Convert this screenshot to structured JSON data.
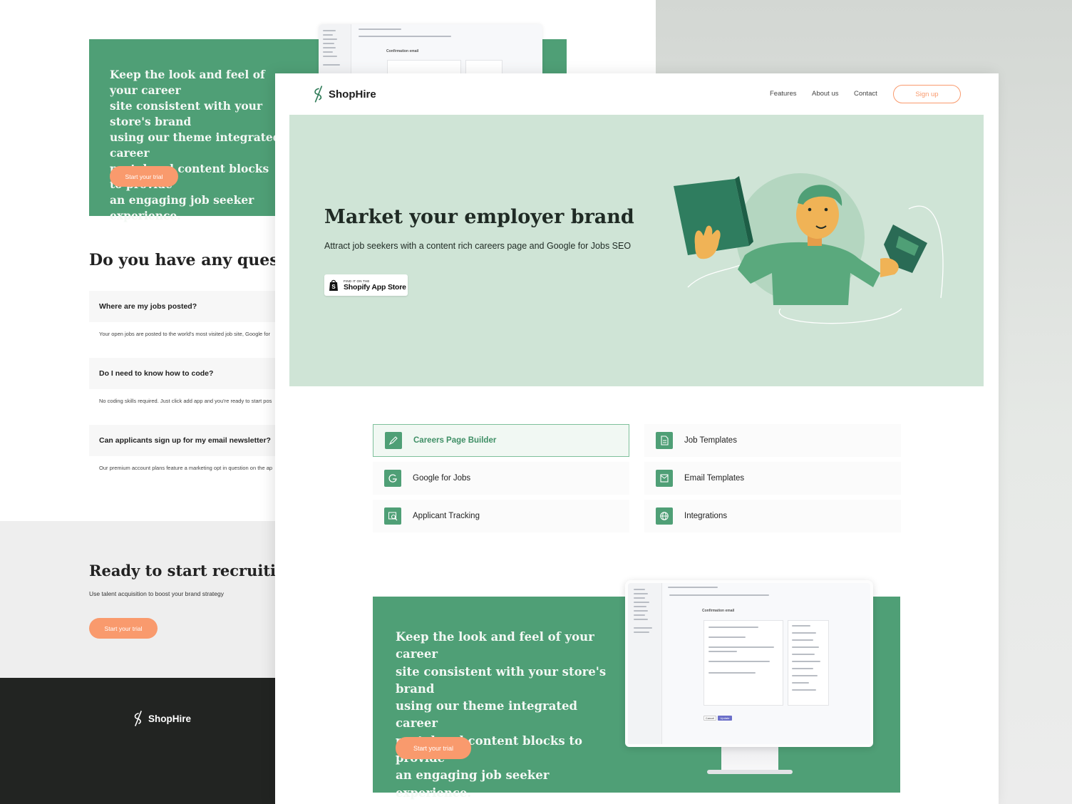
{
  "brand": {
    "name": "ShopHire",
    "accent_green": "#4f9f76",
    "accent_orange": "#f99a6d",
    "hero_bg": "#cfe4d6",
    "footer_bg": "#222422"
  },
  "back_page": {
    "hero_text": "Keep the look and feel of your career\nsite consistent with your store's brand\nusing our theme integrated career\nportal and content blocks to provide\nan engaging job seeker experience.",
    "hero_cta": "Start your trial",
    "screenshot": {
      "title": "Confirmation email"
    },
    "faq_title": "Do you have any questions?",
    "faq": [
      {
        "question": "Where are my jobs posted?",
        "answer": "Your open jobs are posted to the world's most visited job site, Google for"
      },
      {
        "question": "Do I need to know how to code?",
        "answer": "No coding skills required. Just click add app and you're ready to start pos"
      },
      {
        "question": "Can applicants sign up for my email newsletter?",
        "answer": "Our premium account plans feature a marketing opt in question on the ap"
      }
    ],
    "ready_title": "Ready to start recruiting?",
    "ready_sub": "Use talent acquisition to boost your brand strategy",
    "ready_cta": "Start your trial",
    "footer_logo": "ShopHire"
  },
  "nav": {
    "logo": "ShopHire",
    "links": [
      "Features",
      "About us",
      "Contact"
    ],
    "signup": "Sign up"
  },
  "hero": {
    "title": "Market your employer brand",
    "subtitle": "Attract job seekers with a content rich careers page and Google for Jobs SEO",
    "badge_small": "FIND IT ON THE",
    "badge_big": "Shopify App Store"
  },
  "features": [
    {
      "label": "Careers Page Builder",
      "icon": "pencil-icon",
      "active": true
    },
    {
      "label": "Job Templates",
      "icon": "document-icon",
      "active": false
    },
    {
      "label": "Google for Jobs",
      "icon": "google-icon",
      "active": false
    },
    {
      "label": "Email Templates",
      "icon": "email-icon",
      "active": false
    },
    {
      "label": "Applicant Tracking",
      "icon": "search-icon",
      "active": false
    },
    {
      "label": "Integrations",
      "icon": "globe-icon",
      "active": false
    }
  ],
  "promo": {
    "text": "Keep the look and feel of your career\nsite consistent with your store's brand\nusing our theme integrated career\nportal and content blocks to provide\nan engaging job seeker experience.",
    "cta": "Start your trial",
    "screen_title": "Confirmation email",
    "screen_cancel": "Cancel",
    "screen_save": "Update"
  }
}
